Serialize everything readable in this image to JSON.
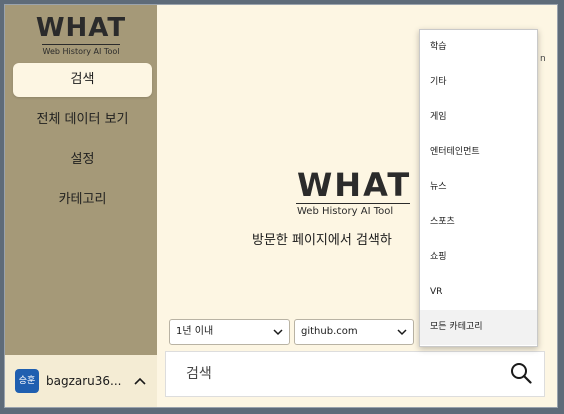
{
  "sidebar": {
    "brand_title": "WHAT",
    "brand_sub": "Web History AI Tool",
    "items": [
      {
        "label": "검색",
        "active": true
      },
      {
        "label": "전체 데이터 보기"
      },
      {
        "label": "설정"
      },
      {
        "label": "카테고리"
      }
    ],
    "user": {
      "avatar": "승훈",
      "name": "bagzaru36...",
      "caret_icon": "chevron-up-icon"
    }
  },
  "main": {
    "hero_title": "WHAT",
    "hero_sub": "Web History AI Tool",
    "hero_tag": "방문한 페이지에서 검색하",
    "filters": {
      "period": "1년 이내",
      "domain": "github.com"
    },
    "search": {
      "placeholder": "검색",
      "icon": "search-icon"
    }
  },
  "dropdown": {
    "items": [
      "학습",
      "기타",
      "게임",
      "엔터테인먼트",
      "뉴스",
      "스포츠",
      "쇼핑",
      "VR",
      "모든 카테고리"
    ],
    "selected": "모든 카테고리"
  },
  "background_text": "n"
}
